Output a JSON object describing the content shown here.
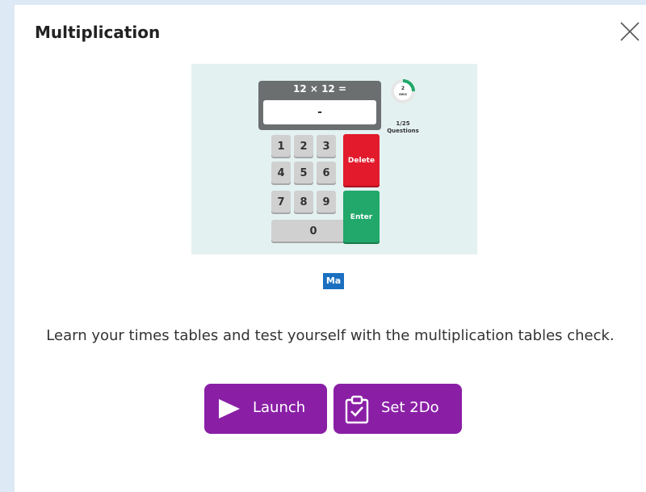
{
  "modal": {
    "title": "Multiplication",
    "close_icon": "close-icon"
  },
  "preview": {
    "question": "12 × 12 =",
    "answer_value": "-",
    "timer_value": "2",
    "timer_unit": "secs",
    "counter_value": "1/25",
    "counter_label": "Questions",
    "keys": [
      "1",
      "2",
      "3",
      "4",
      "5",
      "6",
      "7",
      "8",
      "9",
      "0"
    ],
    "delete_label": "Delete",
    "enter_label": "Enter",
    "colors": {
      "delete": "#e21a2c",
      "enter": "#21a86a",
      "timer_progress": "#21a86a"
    }
  },
  "subject_badge": "Ma",
  "description": "Learn your times tables and test yourself with the multiplication tables check.",
  "actions": {
    "launch_label": "Launch",
    "launch_icon": "play-icon",
    "set2do_label": "Set 2Do",
    "set2do_icon": "clipboard-check-icon",
    "button_color": "#8a1fa6"
  }
}
